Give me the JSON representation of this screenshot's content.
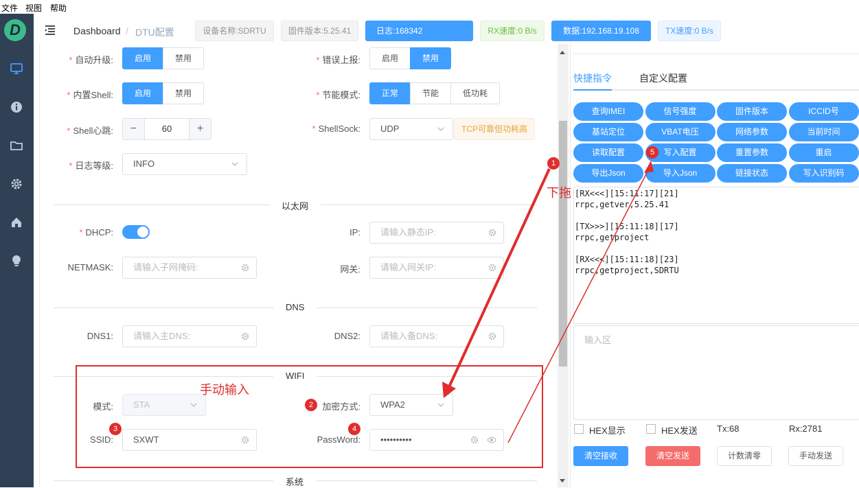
{
  "menu": [
    "文件",
    "视图",
    "帮助"
  ],
  "breadcrumb": {
    "home": "Dashboard",
    "sep": "/",
    "current": "DTU配置"
  },
  "header": {
    "device_name": "设备名称:SDRTU",
    "firmware": "固件版本:5.25.41",
    "log": "日志:168342",
    "rx_speed": "RX速度:0 B/s",
    "data_addr": "数据:192.168.19.108",
    "tx_speed": "TX速度:0 B/s"
  },
  "form": {
    "auto_upgrade": {
      "label": "自动升级:",
      "options": [
        "启用",
        "禁用"
      ],
      "selected": 0
    },
    "error_report": {
      "label": "错误上报:",
      "options": [
        "启用",
        "禁用"
      ],
      "selected": 1
    },
    "builtin_shell": {
      "label": "内置Shell:",
      "options": [
        "启用",
        "禁用"
      ],
      "selected": 0
    },
    "power_mode": {
      "label": "节能模式:",
      "options": [
        "正常",
        "节能",
        "低功耗"
      ],
      "selected": 0
    },
    "shell_heartbeat": {
      "label": "Shell心跳:",
      "value": "60",
      "minus": "−",
      "plus": "+"
    },
    "shell_sock": {
      "label": "ShellSock:",
      "value": "UDP",
      "hint": "TCP可靠但功耗高"
    },
    "log_level": {
      "label": "日志等级:",
      "value": "INFO"
    },
    "ethernet_title": "以太网",
    "dhcp": {
      "label": "DHCP:",
      "on": true
    },
    "ip": {
      "label": "IP:",
      "placeholder": "请输入静态IP:"
    },
    "netmask": {
      "label": "NETMASK:",
      "placeholder": "请输入子网掩码:"
    },
    "gateway": {
      "label": "网关:",
      "placeholder": "请输入网关IP:"
    },
    "dns_title": "DNS",
    "dns1": {
      "label": "DNS1:",
      "placeholder": "请输入主DNS:"
    },
    "dns2": {
      "label": "DNS2:",
      "placeholder": "请输入备DNS:"
    },
    "wifi_title": "WIFI",
    "mode": {
      "label": "模式:",
      "value": "STA"
    },
    "encryption": {
      "label": "加密方式:",
      "value": "WPA2"
    },
    "ssid": {
      "label": "SSID:",
      "value": "SXWT"
    },
    "password": {
      "label": "PassWord:",
      "value": "••••••••••"
    },
    "system_title": "系统"
  },
  "right": {
    "tabs": [
      "快捷指令",
      "自定义配置"
    ],
    "active_tab": 0,
    "quick_buttons": [
      "查询IMEI",
      "信号强度",
      "固件版本",
      "ICCID号",
      "基站定位",
      "VBAT电压",
      "网络参数",
      "当前时间",
      "读取配置",
      "写入配置",
      "重置参数",
      "重启",
      "导出Json",
      "导入Json",
      "链接状态",
      "写入识别码"
    ],
    "log_lines": [
      "[RX<<<][15:11:17][21]",
      "rrpc,getver,5.25.41",
      "",
      "[TX>>>][15:11:18][17]",
      "rrpc,getproject",
      "",
      "[RX<<<][15:11:18][23]",
      "rrpc,getproject,SDRTU"
    ],
    "input_placeholder": "输入区",
    "hex_show": "HEX显示",
    "hex_send": "HEX发送",
    "tx_count": "Tx:68",
    "rx_count": "Rx:2781",
    "btn_clear_recv": "清空接收",
    "btn_clear_send": "清空发送",
    "btn_reset_count": "计数清零",
    "btn_manual_send": "手动发送"
  },
  "annotations": {
    "drag_down": "下拖",
    "manual_input": "手动输入",
    "badges": [
      "1",
      "2",
      "3",
      "4",
      "5"
    ]
  },
  "colors": {
    "primary": "#409eff",
    "danger": "#f56c6c",
    "sidebar": "#304156",
    "annotation": "#e02d2d",
    "success": "#67c23a"
  }
}
